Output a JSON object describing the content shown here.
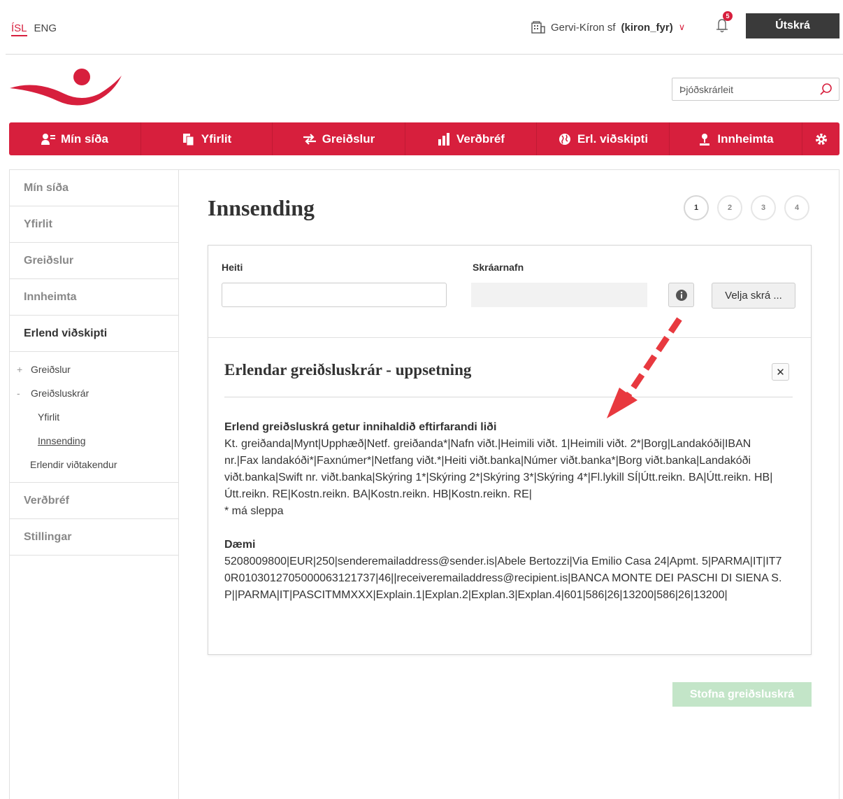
{
  "topbar": {
    "lang_active": "ÍSL",
    "lang_other": "ENG",
    "company_name": "Gervi-Kíron sf",
    "username": "(kiron_fyr)",
    "notifications_count": "5",
    "logout_label": "Útskrá"
  },
  "search": {
    "placeholder": "Þjóðskrárleit"
  },
  "nav": {
    "items": [
      {
        "label": "Mín síða",
        "icon": "user-list-icon"
      },
      {
        "label": "Yfirlit",
        "icon": "documents-icon"
      },
      {
        "label": "Greiðslur",
        "icon": "transfer-arrows-icon"
      },
      {
        "label": "Verðbréf",
        "icon": "bar-chart-icon"
      },
      {
        "label": "Erl. viðskipti",
        "icon": "globe-icon"
      },
      {
        "label": "Innheimta",
        "icon": "user-upload-icon"
      }
    ],
    "settings_icon": "gear-icon"
  },
  "sidebar": {
    "items": [
      {
        "label": "Mín síða"
      },
      {
        "label": "Yfirlit"
      },
      {
        "label": "Greiðslur"
      },
      {
        "label": "Innheimta"
      },
      {
        "label": "Erlend viðskipti"
      },
      {
        "label": "Verðbréf"
      },
      {
        "label": "Stillingar"
      }
    ],
    "sub_items": [
      {
        "mark": "+",
        "label": "Greiðslur"
      },
      {
        "mark": "-",
        "label": "Greiðsluskrár"
      },
      {
        "mark": "",
        "label": "Yfirlit"
      },
      {
        "mark": "",
        "label": "Innsending"
      },
      {
        "mark": "",
        "label": "Erlendir viðtakendur"
      }
    ]
  },
  "main": {
    "title": "Innsending",
    "steps": [
      "1",
      "2",
      "3",
      "4"
    ],
    "form": {
      "heiti_label": "Heiti",
      "heiti_value": "",
      "file_label": "Skráarnafn",
      "file_value": "",
      "choose_file_label": "Velja skrá ..."
    },
    "info": {
      "title": "Erlendar greiðsluskrár - uppsetning",
      "heading": "Erlend greiðsluskrá getur innihaldið eftirfarandi liði",
      "fields_text": "Kt. greiðanda|Mynt|Upphæð|Netf. greiðanda*|Nafn viðt.|Heimili viðt. 1|Heimili viðt. 2*|Borg|Landakóði|IBAN nr.|Fax landakóði*|Faxnúmer*|Netfang viðt.*|Heiti viðt.banka|Númer viðt.banka*|Borg viðt.banka|Landakóði viðt.banka|Swift nr. viðt.banka|Skýring 1*|Skýring 2*|Skýring 3*|Skýring 4*|Fl.lykill SÍ|Útt.reikn. BA|Útt.reikn. HB|Útt.reikn. RE|Kostn.reikn. BA|Kostn.reikn. HB|Kostn.reikn. RE|",
      "optional_note": "* má sleppa",
      "example_heading": "Dæmi",
      "example_text": "5208009800|EUR|250|senderemailaddress@sender.is|Abele Bertozzi|Via Emilio Casa 24|Apmt. 5|PARMA|IT|IT70R0103012705000063121737|46||receiveremailaddress@recipient.is|BANCA MONTE DEI PASCHI DI SIENA S.P||PARMA|IT|PASCITMMXXX|Explain.1|Explan.2|Explan.3|Explan.4|601|586|26|13200|586|26|13200|"
    },
    "create_button_label": "Stofna greiðsluskrá"
  },
  "colors": {
    "brand_red": "#d71f3d",
    "logout_bg": "#3a3a3a",
    "create_button_disabled": "#c3e5c8"
  }
}
